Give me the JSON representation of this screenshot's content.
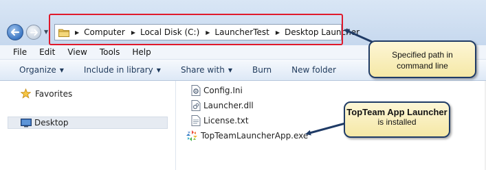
{
  "address_bar": {
    "breadcrumbs": [
      "Computer",
      "Local Disk (C:)",
      "LauncherTest",
      "Desktop Launcher"
    ]
  },
  "menubar": {
    "items": [
      "File",
      "Edit",
      "View",
      "Tools",
      "Help"
    ]
  },
  "command_bar": {
    "organize": "Organize",
    "include_in_library": "Include in library",
    "share_with": "Share with",
    "burn": "Burn",
    "new_folder": "New folder"
  },
  "nav_pane": {
    "favorites": "Favorites",
    "desktop": "Desktop"
  },
  "files": [
    {
      "name": "Config.Ini",
      "icon": "config-file-icon"
    },
    {
      "name": "Launcher.dll",
      "icon": "dll-file-icon"
    },
    {
      "name": "License.txt",
      "icon": "text-file-icon"
    },
    {
      "name": "TopTeamLauncherApp.exe",
      "icon": "topteam-app-icon"
    }
  ],
  "callouts": {
    "path": {
      "line1": "Specified path in",
      "line2": "command line"
    },
    "launcher": {
      "line1": "TopTeam App Launcher",
      "line2": "is installed"
    }
  },
  "colors": {
    "highlight_box": "#e0182a",
    "callout_fill": "#f5e8a6",
    "callout_border": "#1f3b66"
  }
}
